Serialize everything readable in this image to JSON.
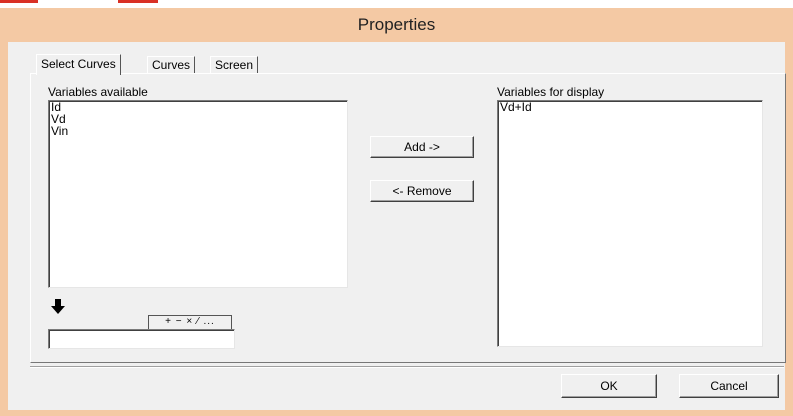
{
  "window": {
    "title": "Properties"
  },
  "tabs": [
    {
      "label": "Select Curves",
      "active": true
    },
    {
      "label": "Curves",
      "active": false
    },
    {
      "label": "Screen",
      "active": false
    }
  ],
  "available": {
    "label": "Variables available",
    "items": [
      "Id",
      "Vd",
      "Vin"
    ]
  },
  "display": {
    "label": "Variables for display",
    "items": [
      "Vd+Id"
    ]
  },
  "buttons": {
    "add": "Add ->",
    "remove": "<- Remove",
    "ok": "OK",
    "cancel": "Cancel"
  },
  "math_bar": {
    "label": "+ − × ⁄ ..."
  },
  "expression_input": {
    "value": ""
  },
  "icons": {
    "insert": "down-arrow-icon"
  },
  "colors": {
    "titlebar": "#f4c9a4",
    "face": "#f0f0f0",
    "mark": "#d93025"
  }
}
